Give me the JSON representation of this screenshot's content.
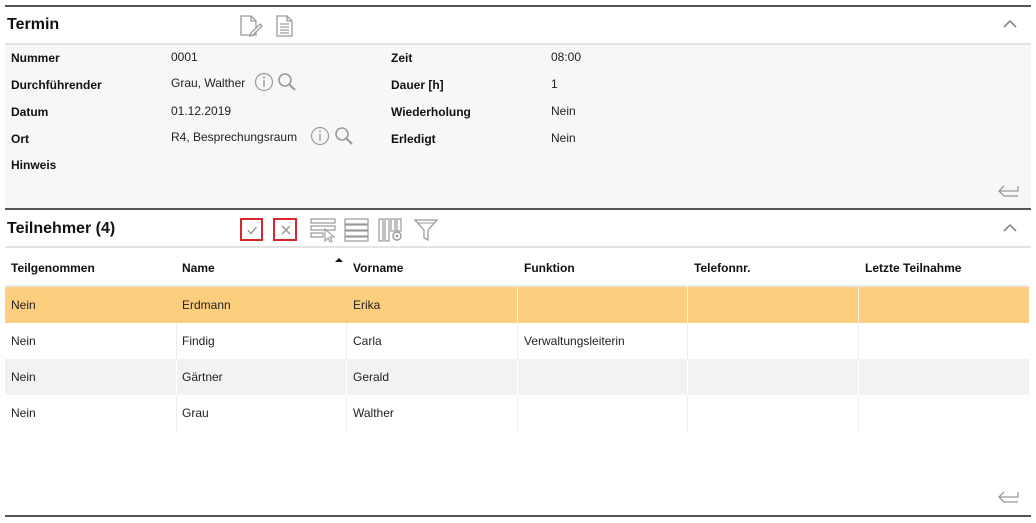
{
  "termin": {
    "title": "Termin",
    "fields_left": [
      {
        "label": "Nummer",
        "value": "0001"
      },
      {
        "label": "Durchführender",
        "value": "Grau, Walther"
      },
      {
        "label": "Datum",
        "value": "01.12.2019"
      },
      {
        "label": "Ort",
        "value": "R4, Besprechungsraum"
      },
      {
        "label": "Hinweis",
        "value": ""
      }
    ],
    "fields_right": [
      {
        "label": "Zeit",
        "value": "08:00"
      },
      {
        "label": "Dauer [h]",
        "value": "1"
      },
      {
        "label": "Wiederholung",
        "value": "Nein"
      },
      {
        "label": "Erledigt",
        "value": "Nein"
      }
    ]
  },
  "teilnehmer": {
    "title": "Teilnehmer (4)",
    "columns": [
      "Teilgenommen",
      "Name",
      "Vorname",
      "Funktion",
      "Telefonnr.",
      "Letzte Teilnahme"
    ],
    "rows": [
      [
        "Nein",
        "Erdmann",
        "Erika",
        "",
        "",
        ""
      ],
      [
        "Nein",
        "Findig",
        "Carla",
        "Verwaltungsleiterin",
        "",
        ""
      ],
      [
        "Nein",
        "Gärtner",
        "Gerald",
        "",
        "",
        ""
      ],
      [
        "Nein",
        "Grau",
        "Walther",
        "",
        "",
        ""
      ]
    ],
    "selected_row": 0,
    "sorted_column": "Name"
  },
  "colors": {
    "selected_row": "#fdce7e",
    "accent_border": "#d9262c",
    "panel_bg": "#f7f7f7",
    "alt_row": "#f2f2f2",
    "icon_gray": "#9a9a9a"
  },
  "icons": {
    "termin_toolbar": [
      "edit-document-icon",
      "document-icon"
    ],
    "teilnehmer_toolbar": [
      "check-icon",
      "close-icon",
      "select-rows-icon",
      "list-view-icon",
      "column-settings-icon",
      "filter-icon"
    ]
  }
}
